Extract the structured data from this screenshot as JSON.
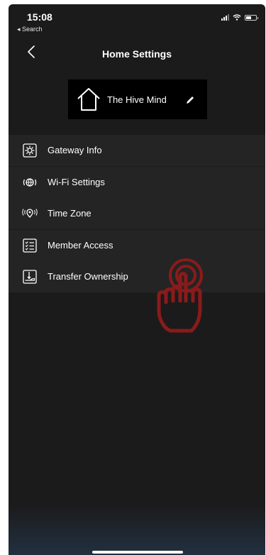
{
  "status_bar": {
    "time": "15:08",
    "back_app": "◂ Search"
  },
  "nav": {
    "title": "Home Settings",
    "back_icon": "chevron-left-icon"
  },
  "home": {
    "name": "The Hive Mind",
    "icon": "house-outline-icon",
    "edit_icon": "pencil-icon"
  },
  "menu": {
    "items": [
      {
        "label": "Gateway Info",
        "icon": "gear-square-icon"
      },
      {
        "label": "Wi-Fi Settings",
        "icon": "globe-signal-icon"
      },
      {
        "label": "Time Zone",
        "icon": "location-signal-icon"
      },
      {
        "label": "Member Access",
        "icon": "checklist-icon"
      },
      {
        "label": "Transfer Ownership",
        "icon": "hand-transfer-icon"
      }
    ]
  },
  "colors": {
    "background": "#1b1b1c",
    "row": "#242425",
    "tap_indicator": "#8b1a1a"
  }
}
